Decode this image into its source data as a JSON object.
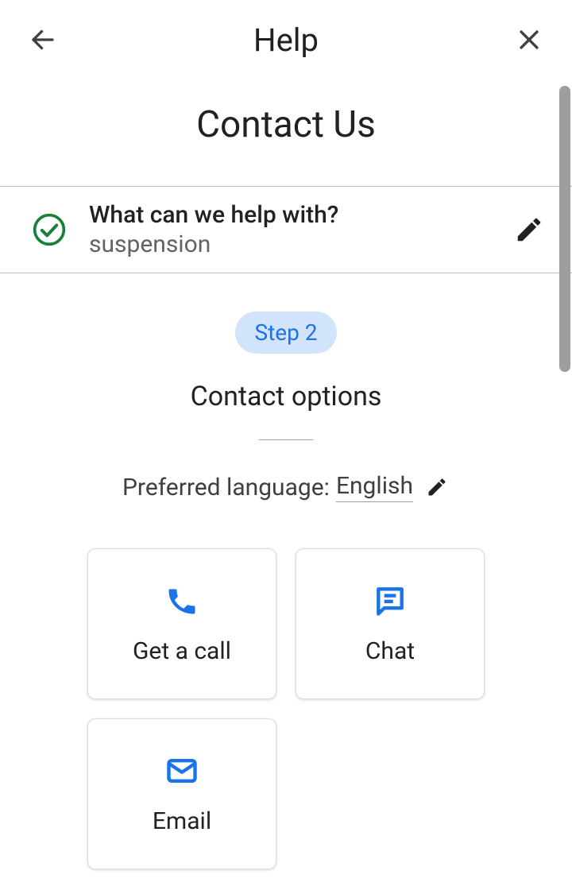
{
  "header": {
    "title": "Help"
  },
  "page": {
    "title": "Contact Us"
  },
  "step1": {
    "question": "What can we help with?",
    "answer": "suspension"
  },
  "step2": {
    "badge": "Step 2",
    "title": "Contact options"
  },
  "language": {
    "label": "Preferred language: ",
    "value": "English"
  },
  "options": {
    "call": "Get a call",
    "chat": "Chat",
    "email": "Email"
  }
}
